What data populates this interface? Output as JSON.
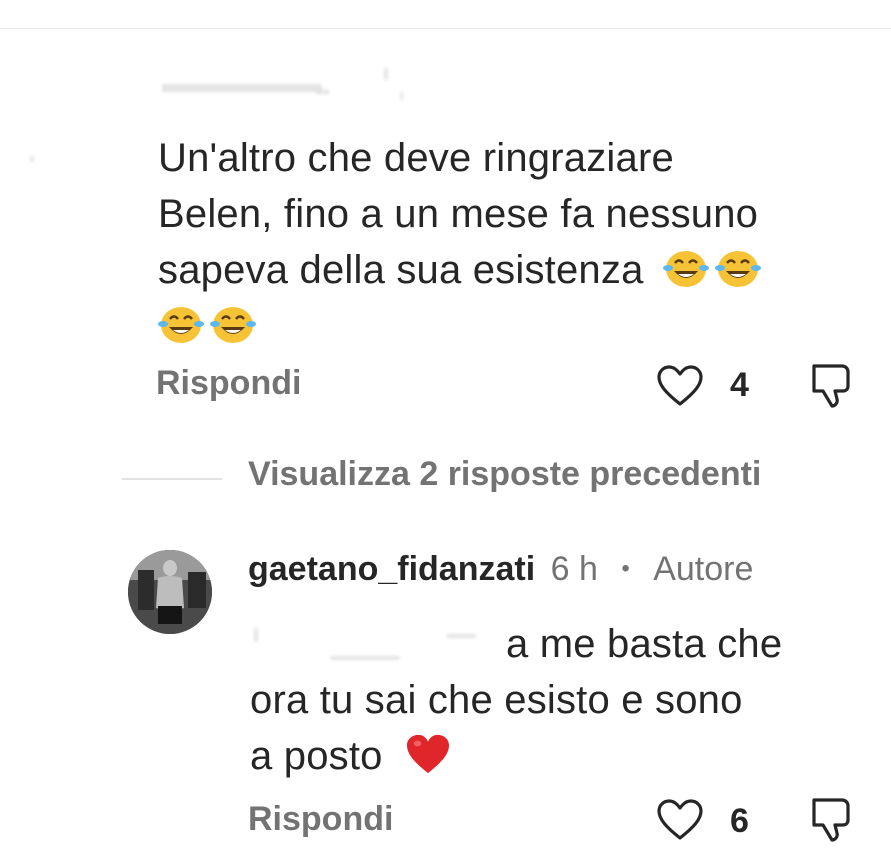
{
  "comment1": {
    "text_line1": "Un'altro che deve ringraziare",
    "text_line2": "Belen, fino a un mese fa nessuno",
    "text_line3": "sapeva della sua esistenza",
    "emojis": [
      "face-with-tears-of-joy-icon",
      "face-with-tears-of-joy-icon",
      "face-with-tears-of-joy-icon",
      "face-with-tears-of-joy-icon"
    ],
    "reply_label": "Rispondi",
    "like_count": "4"
  },
  "view_replies_label": "Visualizza 2 risposte precedenti",
  "comment2": {
    "username": "gaetano_fidanzati",
    "time": "6 h",
    "separator": "•",
    "badge": "Autore",
    "text_line1": "a me basta che",
    "text_line2": "ora tu sai che esisto e sono",
    "text_line3": "a posto",
    "emoji": "red-heart-icon",
    "reply_label": "Rispondi",
    "like_count": "6"
  },
  "colors": {
    "text": "#262626",
    "secondary": "#737373",
    "heart": "#e0252b",
    "emoji_yellow": "#f7c336"
  }
}
